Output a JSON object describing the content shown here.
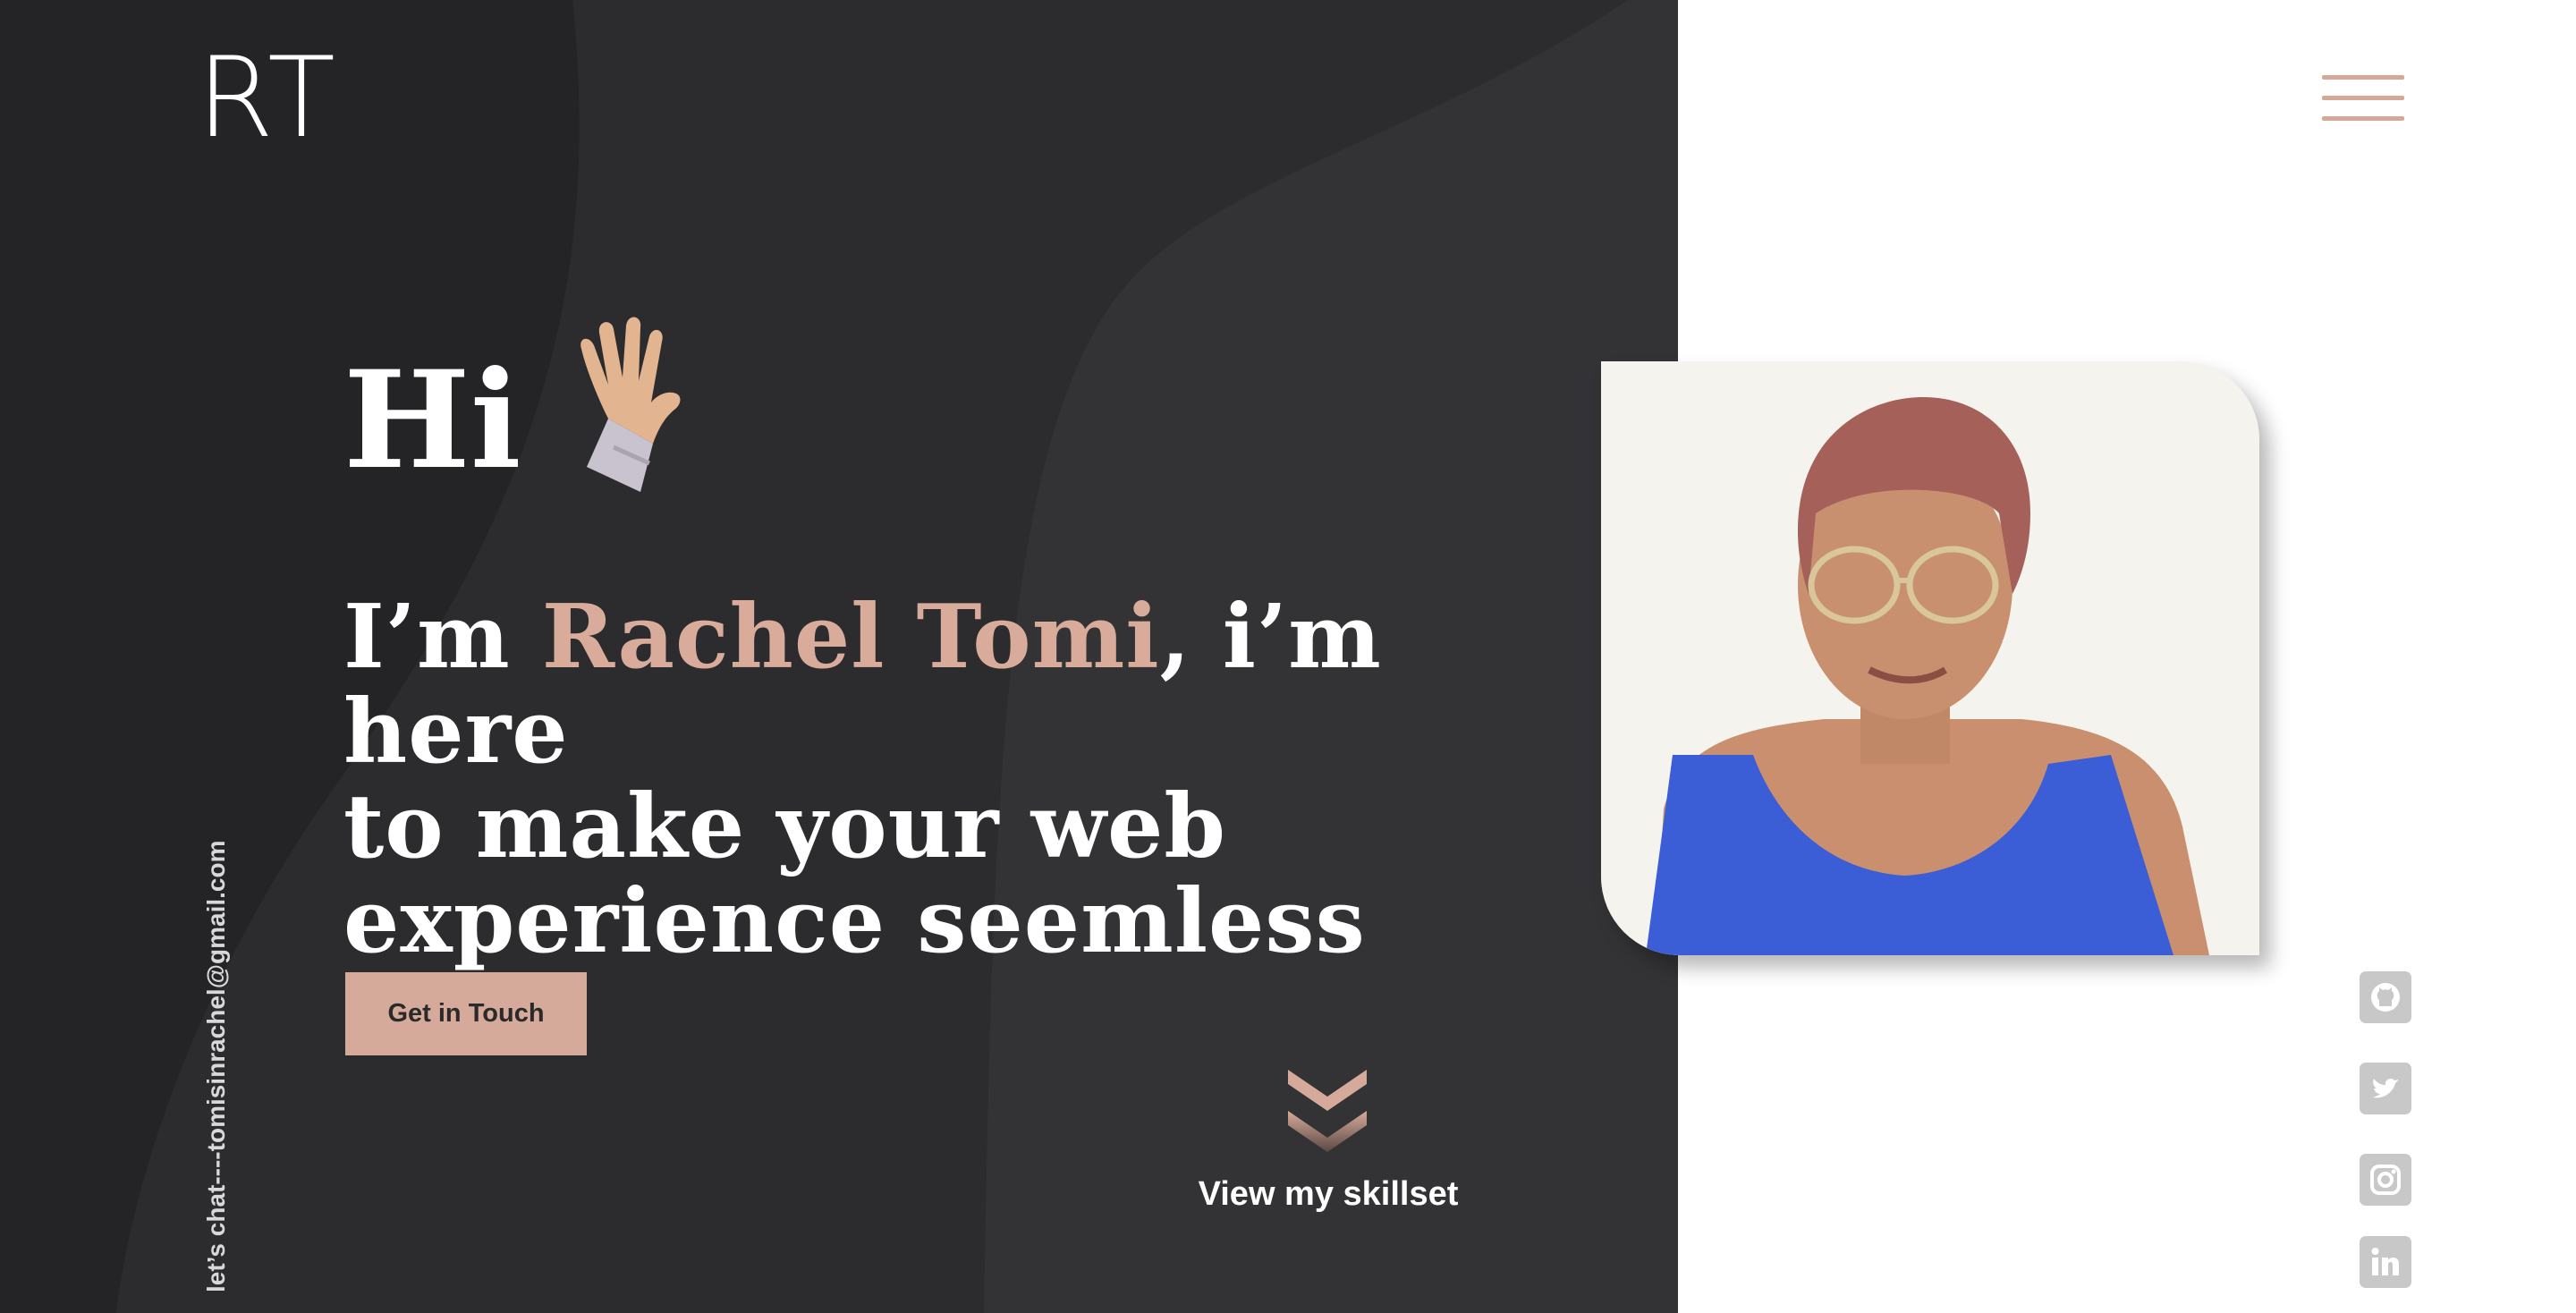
{
  "header": {
    "logo_text": "RT",
    "menu_icon": "hamburger-menu-icon"
  },
  "hero": {
    "greeting": "Hi",
    "greeting_icon": "waving-hand-icon",
    "intro_prefix": "I’m ",
    "name": "Rachel Tomi",
    "intro_suffix_line1": ", i’m here",
    "intro_line2": "to make your web",
    "intro_line3": "experience seemless",
    "cta_label": "Get in Touch"
  },
  "side_contact": {
    "text": "let’s chat----tomisinrachel@gmail.com"
  },
  "scroll": {
    "icon": "double-chevron-down-icon",
    "label": "View my skillset"
  },
  "portrait": {
    "icon": "profile-photo"
  },
  "social_links": [
    {
      "name": "github-icon"
    },
    {
      "name": "twitter-icon"
    },
    {
      "name": "instagram-icon"
    },
    {
      "name": "linkedin-icon"
    }
  ],
  "colors": {
    "dark_background": "#242426",
    "wave_shade": "#303033",
    "accent": "#d6aa9a",
    "icon_gray": "#c8c8c8",
    "text_light": "#ffffff"
  }
}
